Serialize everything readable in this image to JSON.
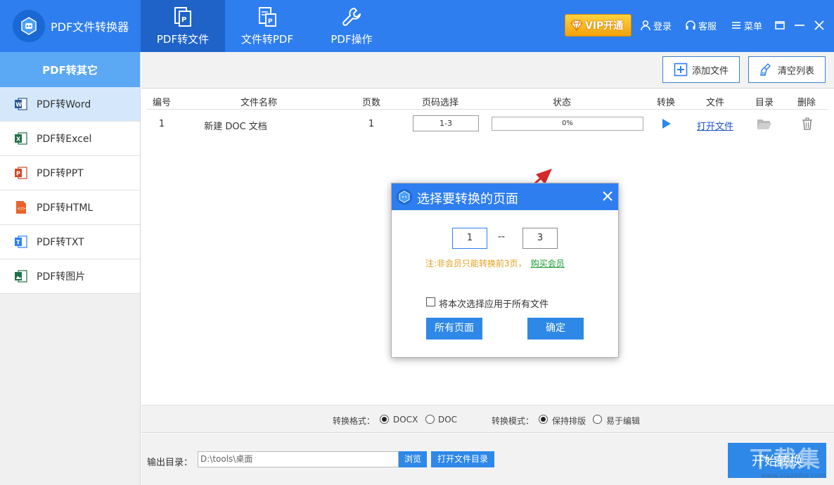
{
  "app": {
    "title": "PDF文件转换器"
  },
  "top_tabs": [
    {
      "label": "PDF转文件",
      "active": true,
      "icon": "pdf-to-file-icon"
    },
    {
      "label": "文件转PDF",
      "active": false,
      "icon": "file-to-pdf-icon"
    },
    {
      "label": "PDF操作",
      "active": false,
      "icon": "wrench-icon"
    }
  ],
  "header_right": {
    "vip_label": "VIP开通",
    "login": "登录",
    "service": "客服",
    "menu": "菜单"
  },
  "sidebar": {
    "heading": "PDF转其它",
    "items": [
      {
        "label": "PDF转Word",
        "icon": "word-icon",
        "color": "#2b5797",
        "active": true
      },
      {
        "label": "PDF转Excel",
        "icon": "excel-icon",
        "color": "#1e7145",
        "active": false
      },
      {
        "label": "PDF转PPT",
        "icon": "ppt-icon",
        "color": "#d24726",
        "active": false
      },
      {
        "label": "PDF转HTML",
        "icon": "html-icon",
        "color": "#e8632b",
        "active": false
      },
      {
        "label": "PDF转TXT",
        "icon": "txt-icon",
        "color": "#2e7ef0",
        "active": false
      },
      {
        "label": "PDF转图片",
        "icon": "image-icon",
        "color": "#1e7145",
        "active": false
      }
    ]
  },
  "toolbar": {
    "add_file": "添加文件",
    "clear_list": "清空列表"
  },
  "table": {
    "headers": [
      "编号",
      "文件名称",
      "页数",
      "页码选择",
      "状态",
      "转换",
      "文件",
      "目录",
      "删除"
    ],
    "rows": [
      {
        "index": "1",
        "name": "新建 DOC 文档",
        "pages": "1",
        "page_range": "1-3",
        "progress": "0%",
        "open_file": "打开文件"
      }
    ]
  },
  "format_bar": {
    "format_label": "转换格式：",
    "format_options": [
      {
        "label": "DOCX",
        "checked": true
      },
      {
        "label": "DOC",
        "checked": false
      }
    ],
    "mode_label": "转换模式：",
    "mode_options": [
      {
        "label": "保持排版",
        "checked": true
      },
      {
        "label": "易于编辑",
        "checked": false
      }
    ]
  },
  "bottom": {
    "output_label": "输出目录：",
    "output_path": "D:\\tools\\桌面",
    "browse": "浏览",
    "open_dir": "打开文件目录",
    "start": "开始转换"
  },
  "dialog": {
    "title": "选择要转换的页面",
    "from_page": "1",
    "separator": "--",
    "to_page": "3",
    "notice": "注:非会员只能转换前3页，",
    "buy_link": "购买会员",
    "apply_all_label": "将本次选择应用于所有文件",
    "apply_all_checked": false,
    "all_pages_btn": "所有页面",
    "ok_btn": "确定"
  },
  "watermark": {
    "text": "下载集",
    "sub": "www.xiazaiba.com"
  },
  "colors": {
    "primary": "#2e7ef0",
    "primary_dark": "#1f63c9",
    "sidebar_head": "#5ba8f4",
    "arrow": "#d42a2a",
    "notice": "#e3a020",
    "buy_link": "#1a9d2e"
  }
}
